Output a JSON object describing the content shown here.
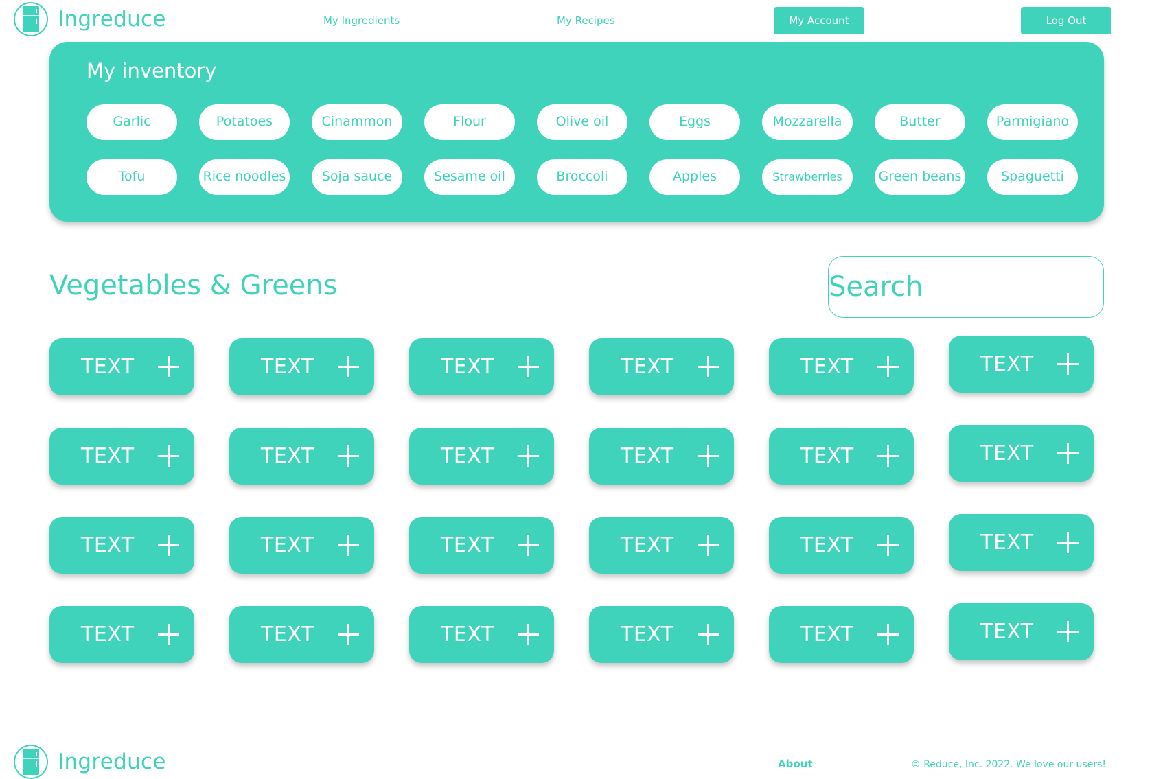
{
  "brand": {
    "name": "Ingreduce",
    "logo_icon": "fridge-icon",
    "accent": "#3fd3bb"
  },
  "nav": {
    "ingredients": "My Ingredients",
    "recipes": "My Recipes",
    "account": "My Account",
    "logout": "Log Out"
  },
  "inventory": {
    "title": "My inventory",
    "items": [
      "Garlic",
      "Potatoes",
      "Cinammon",
      "Flour",
      "Olive oil",
      "Eggs",
      "Mozzarella",
      "Butter",
      "Parmigiano",
      "Tofu",
      "Rice noodles",
      "Soja sauce",
      "Sesame oil",
      "Broccoli",
      "Apples",
      "Strawberries",
      "Green beans",
      "Spaguetti"
    ]
  },
  "category": {
    "title": "Vegetables & Greens",
    "search_placeholder": "Search",
    "tile_label": "TEXT",
    "tile_icon": "plus-icon"
  },
  "footer": {
    "brand": "Ingreduce",
    "about": "About",
    "copyright": "© Reduce, Inc. 2022. We love our users!"
  }
}
